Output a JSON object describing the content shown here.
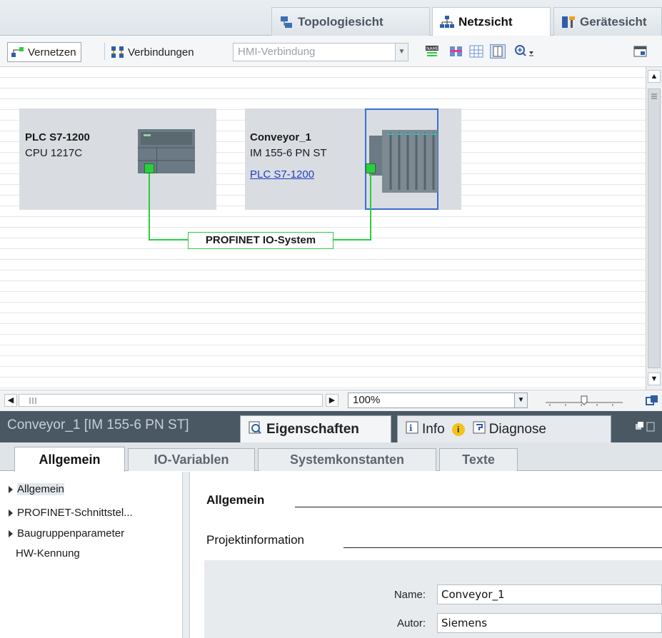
{
  "view_tabs": {
    "topology": "Topologiesicht",
    "network": "Netzsicht",
    "device": "Gerätesicht"
  },
  "toolbar": {
    "vernetzen": "Vernetzen",
    "verbindungen": "Verbindungen",
    "hmi_select_value": "HMI-Verbindung"
  },
  "canvas": {
    "devices": [
      {
        "name": "PLC S7-1200",
        "type": "CPU 1217C"
      },
      {
        "name": "Conveyor_1",
        "type": "IM 155-6 PN ST",
        "link": "PLC S7-1200"
      }
    ],
    "network_label": "PROFINET IO-System",
    "zoom": "100%"
  },
  "inspector": {
    "title": "Conveyor_1 [IM 155-6 PN ST]",
    "tabs": {
      "properties": "Eigenschaften",
      "info": "Info",
      "diagnose": "Diagnose"
    },
    "subtabs": [
      "Allgemein",
      "IO-Variablen",
      "Systemkonstanten",
      "Texte"
    ],
    "nav": [
      "Allgemein",
      "PROFINET-Schnittstel...",
      "Baugruppenparameter",
      "HW-Kennung"
    ],
    "section_general": "Allgemein",
    "section_project": "Projektinformation",
    "fields": {
      "name_label": "Name:",
      "name_value": "Conveyor_1",
      "author_label": "Autor:",
      "author_value": "Siemens"
    }
  }
}
